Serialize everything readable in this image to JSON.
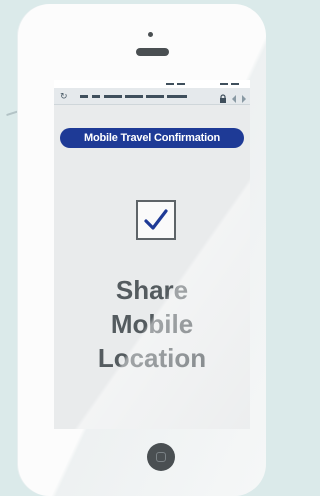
{
  "banner": {
    "label": "Mobile Travel Confirmation"
  },
  "headline": {
    "line1": "Share",
    "line2": "Mobile",
    "line3": "Location"
  },
  "icons": {
    "checkbox": "checkmark-icon",
    "reload": "reload-icon",
    "lock": "lock-icon",
    "back": "back-arrow-icon",
    "forward": "forward-arrow-icon",
    "home": "home-button-icon"
  },
  "colors": {
    "background": "#dbeaea",
    "banner": "#1e3a96",
    "checkmark": "#1e3a96",
    "text": "#545b5f",
    "device_dark": "#4a4f52"
  }
}
